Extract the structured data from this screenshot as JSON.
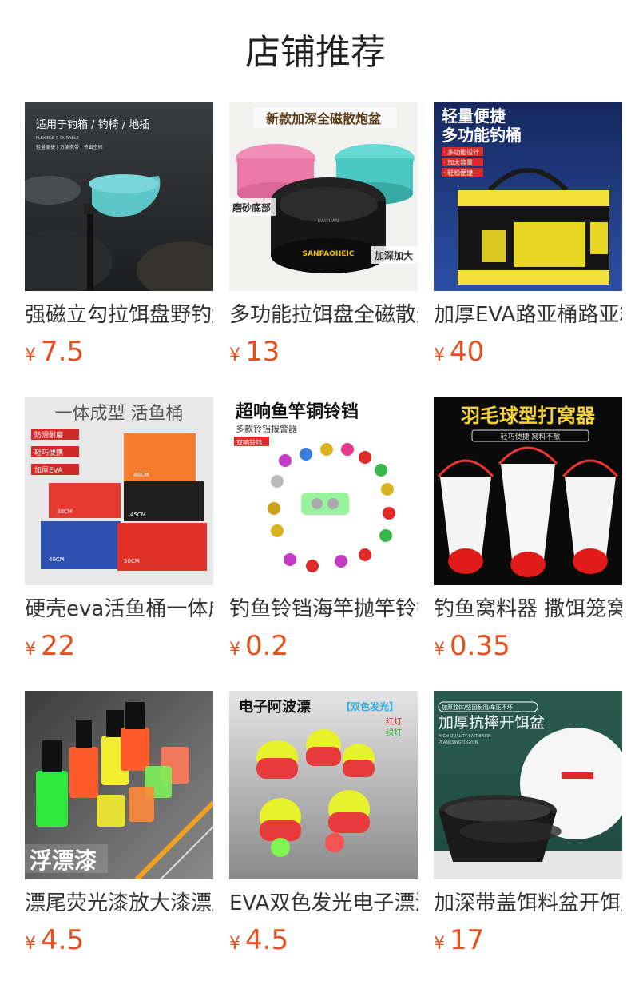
{
  "section": {
    "title": "店铺推荐"
  },
  "colors": {
    "price": "#e6501e",
    "text": "#333333"
  },
  "products": [
    {
      "name": "强磁立勾拉饵盘野钓盘",
      "price": "7.5",
      "currency": "¥",
      "icon": "bait-tray-image",
      "overlay": [
        "适用于钓箱 / 钓椅 / 地插",
        "FLEXIBLE & DURABLE",
        "轻量便捷 | 方便携带 | 节省空间"
      ]
    },
    {
      "name": "多功能拉饵盘全磁散炮盆",
      "price": "13",
      "currency": "¥",
      "icon": "magnetic-bowls-image",
      "overlay": [
        "新款加深全磁散炮盆",
        "磨砂底部",
        "加深加大",
        "SANPAOHEIC",
        "DAIYUAN"
      ]
    },
    {
      "name": "加厚EVA路亚桶路亚箱",
      "price": "40",
      "currency": "¥",
      "icon": "fishing-bucket-image",
      "overlay": [
        "轻量便捷",
        "多功能钓桶",
        "· 多功能设计",
        "· 加大容量",
        "· 轻松便捷"
      ]
    },
    {
      "name": "硬壳eva活鱼桶一体成型",
      "price": "22",
      "currency": "¥",
      "icon": "live-fish-bucket-image",
      "overlay": [
        "一体成型 活鱼桶",
        "防滑耐磨",
        "轻巧便携",
        "加厚EVA",
        "40CM",
        "30CM",
        "45CM",
        "40CM",
        "50CM"
      ]
    },
    {
      "name": "钓鱼铃铛海竿抛竿铃铛",
      "price": "0.2",
      "currency": "¥",
      "icon": "bell-alarm-image",
      "overlay": [
        "超响鱼竿铜铃铛",
        "多款铃铛报警器",
        "双响铃铛"
      ]
    },
    {
      "name": "钓鱼窝料器 撒饵笼窝料",
      "price": "0.35",
      "currency": "¥",
      "icon": "bait-cage-image",
      "overlay": [
        "羽毛球型打窝器",
        "轻巧便捷 窝料不散"
      ]
    },
    {
      "name": "漂尾荧光漆放大漆漂尾",
      "price": "4.5",
      "currency": "¥",
      "icon": "fluorescent-paint-image",
      "overlay": [
        "浮漂漆"
      ]
    },
    {
      "name": "EVA双色发光电子漂漂",
      "price": "4.5",
      "currency": "¥",
      "icon": "electronic-float-image",
      "overlay": [
        "电子阿波漂",
        "【双色发光】",
        "红灯",
        "绿灯"
      ]
    },
    {
      "name": "加深带盖饵料盆开饵盆",
      "price": "17",
      "currency": "¥",
      "icon": "bait-basin-image",
      "overlay": [
        "加厚盆体/坚固耐用/车压不坏",
        "加厚抗摔开饵盆",
        "HIGH QUALITY BAIT BASIN",
        "PLANKSINGTOGYUN"
      ]
    }
  ]
}
